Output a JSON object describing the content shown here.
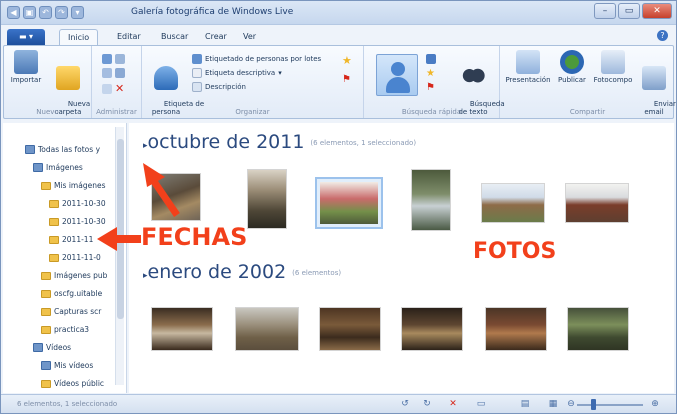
{
  "window": {
    "title": "Galería fotográfica de Windows Live"
  },
  "qat": [
    "◀",
    "▣",
    "↶",
    "↷",
    "▾"
  ],
  "window_controls": {
    "minimize": "–",
    "maximize": "▭",
    "close": "✕"
  },
  "tabs": [
    {
      "label": "▬ ▾"
    },
    {
      "label": "Inicio"
    },
    {
      "label": "Editar"
    },
    {
      "label": "Buscar"
    },
    {
      "label": "Crear"
    },
    {
      "label": "Ver"
    }
  ],
  "help": "?",
  "ribbon": {
    "nuevo": {
      "label": "Nuevo",
      "importar": "Importar",
      "nueva_carpeta": "Nueva\ncarpeta"
    },
    "administrar": {
      "label": "Administrar"
    },
    "organizar": {
      "label": "Organizar",
      "etiqueta_persona": "Etiqueta de\npersona",
      "etiquetado_personas": "Etiquetado de personas por lotes",
      "etiqueta_descriptiva": "Etiqueta descriptiva",
      "descripcion": "Descripción"
    },
    "busqueda": {
      "label": "Búsqueda rápida",
      "busqueda_texto": "Búsqueda\nde texto"
    },
    "compartir": {
      "label": "Compartir",
      "presentacion": "Presentación",
      "publicar": "Publicar",
      "fotocomposicion": "Fotocompo",
      "enviar_mail": "Enviar\nemail"
    }
  },
  "sidebar": {
    "items": [
      {
        "label": "Todas las fotos y",
        "icon": "library-icon"
      },
      {
        "label": "Imágenes",
        "icon": "library-icon"
      },
      {
        "label": "Mis imágenes",
        "icon": "folder-icon"
      },
      {
        "label": "2011-10-30",
        "icon": "folder-icon"
      },
      {
        "label": "2011-10-30",
        "icon": "folder-icon"
      },
      {
        "label": "2011-11",
        "icon": "folder-icon"
      },
      {
        "label": "2011-11-0",
        "icon": "folder-icon"
      },
      {
        "label": "Imágenes pub",
        "icon": "folder-icon"
      },
      {
        "label": "oscfg.uitable",
        "icon": "folder-icon"
      },
      {
        "label": "Capturas scr",
        "icon": "folder-icon"
      },
      {
        "label": "practica3",
        "icon": "folder-icon"
      },
      {
        "label": "Vídeos",
        "icon": "library-icon"
      },
      {
        "label": "Mis vídeos",
        "icon": "library-icon"
      },
      {
        "label": "Vídeos públic",
        "icon": "folder-icon"
      }
    ]
  },
  "main": {
    "groups": [
      {
        "title": "octubre de 2011",
        "count": "(6 elementos, 1 seleccionado)"
      },
      {
        "title": "enero de 2002",
        "count": "(6 elementos)"
      }
    ]
  },
  "annotations": {
    "fechas": "FECHAS",
    "fotos": "FOTOS"
  },
  "statusbar": {
    "text": "6 elementos, 1 seleccionado"
  },
  "colors": {
    "accent": "#2b4a7f",
    "annotation": "#f2401b"
  }
}
